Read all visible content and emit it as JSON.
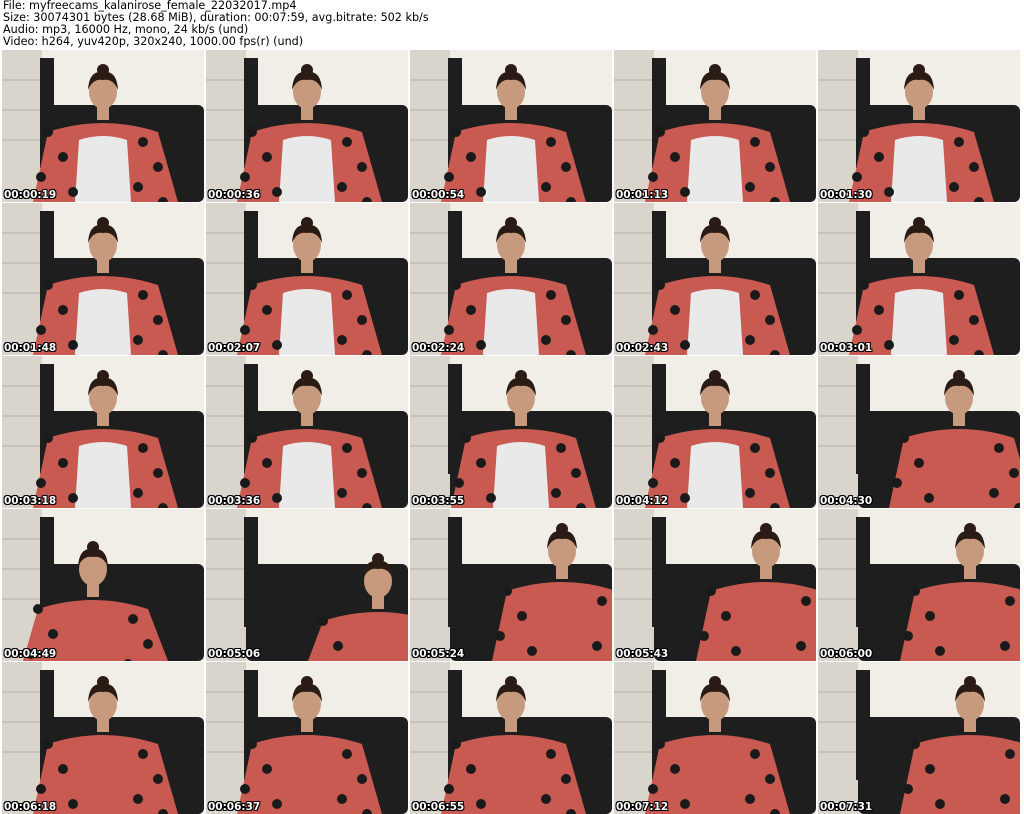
{
  "header": {
    "file_line": "File: myfreecams_kalanirose_female_22032017.mp4",
    "size_line": "Size: 30074301 bytes (28.68 MiB), duration: 00:07:59, avg.bitrate: 502 kb/s",
    "audio_line": "Audio: mp3, 16000 Hz, mono, 24 kb/s (und)",
    "video_line": "Video: h264, yuv420p, 320x240, 1000.00 fps(r) (und)"
  },
  "thumbnails": [
    {
      "timestamp": "00:00:19"
    },
    {
      "timestamp": "00:00:36"
    },
    {
      "timestamp": "00:00:54"
    },
    {
      "timestamp": "00:01:13"
    },
    {
      "timestamp": "00:01:30"
    },
    {
      "timestamp": "00:01:48"
    },
    {
      "timestamp": "00:02:07"
    },
    {
      "timestamp": "00:02:24"
    },
    {
      "timestamp": "00:02:43"
    },
    {
      "timestamp": "00:03:01"
    },
    {
      "timestamp": "00:03:18"
    },
    {
      "timestamp": "00:03:36"
    },
    {
      "timestamp": "00:03:55"
    },
    {
      "timestamp": "00:04:12"
    },
    {
      "timestamp": "00:04:30"
    },
    {
      "timestamp": "00:04:49"
    },
    {
      "timestamp": "00:05:06"
    },
    {
      "timestamp": "00:05:24"
    },
    {
      "timestamp": "00:05:43"
    },
    {
      "timestamp": "00:06:00"
    },
    {
      "timestamp": "00:06:18"
    },
    {
      "timestamp": "00:06:37"
    },
    {
      "timestamp": "00:06:55"
    },
    {
      "timestamp": "00:07:12"
    },
    {
      "timestamp": "00:07:31"
    }
  ],
  "colors": {
    "wall": "#f1eee8",
    "chair": "#1e1e1e",
    "blanket": "#c85a52",
    "dots": "#1a1a1a",
    "shirt": "#e9e9ea",
    "skin": "#c79a7e",
    "hair": "#2a1c14",
    "timestamp_text": "#ffffff"
  }
}
